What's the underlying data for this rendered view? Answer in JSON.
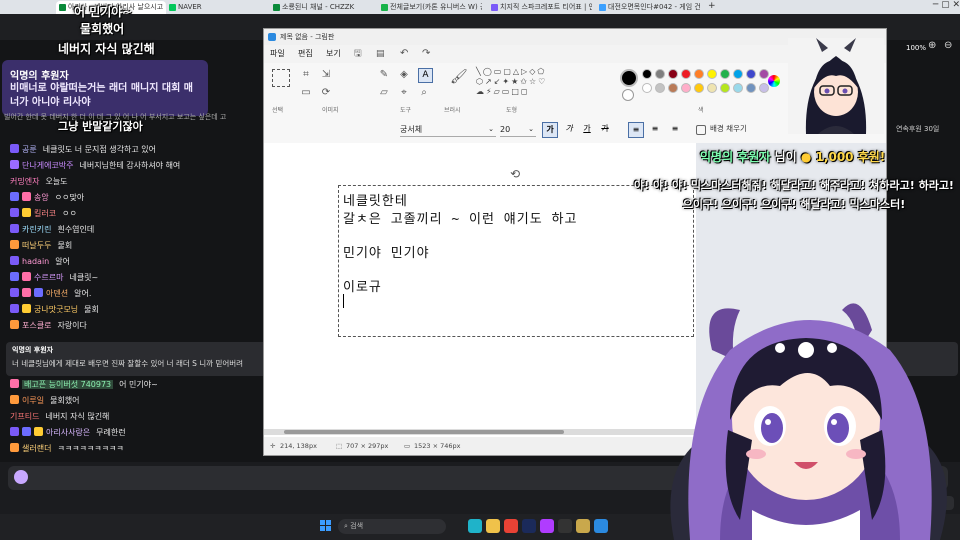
{
  "browser": {
    "tabs": [
      {
        "label": "아리사 - 네버지 아리사 날으시고 바치적상 CI - CHZZK",
        "color": "#0a8a3a",
        "active": true
      },
      {
        "label": "NAVER",
        "color": "#03c75a"
      },
      {
        "label": "소룡된니 채널 - CHZZK",
        "color": "#0a8a3a"
      },
      {
        "label": "전체글보기(카톤 유니버스 W) 공",
        "color": "#19b34a"
      },
      {
        "label": "치지직 스파크레포트 티어표 | 인",
        "color": "#7a5af8"
      },
      {
        "label": "대전오면목인다#042 - 게임 건의",
        "color": "#3ba0ff"
      }
    ],
    "page_title": "아리사 - 네버지 아리사 날으시고 바치적상 CI - CHZZK"
  },
  "overlay": {
    "top_lines": [
      "어 민기야~",
      "물회했어",
      "네버지 자식 많긴해"
    ],
    "mid_line": "그냥 반말같기잖아",
    "donation_top": {
      "title": "익명의 후원자",
      "message": "비매너로 야랄떠는거는 래더 매니지 대회 매너가 아니야 리사야"
    },
    "big_donation": {
      "prefix": "익명의 후원자",
      "suffix": "님이",
      "amount": "1,000 후원!",
      "message": "야! 야! 야! 믹스마스터해줘! 해달라고! 해주라고! 쳐하라고! 하라고! 으이구! 으이구! 으이구! 해달라고! 믹스마스터!"
    },
    "subscribe_text": "연속후원 30일",
    "chat_head_text": "빌어간 한데 못 데버지 한 더 이 데 그 있 어 나 어 부서지고 보고는 싶은데 고"
  },
  "chat": [
    {
      "nick": "공룬",
      "nick_color": "#b9b9ff",
      "msg": "네클릿도 너 문지점 생각하고 있어",
      "badges": [
        "#7a5af8"
      ]
    },
    {
      "nick": "단나게에코박주",
      "nick_color": "#c98cff",
      "msg": "네버지님한테 감사하셔야 해여",
      "badges": [
        "#9b6cff"
      ]
    },
    {
      "nick": "커밍엔자",
      "nick_color": "#ff7fbf",
      "msg": "오늘도",
      "badges": []
    },
    {
      "nick": "송앙",
      "nick_color": "#ff9ad5",
      "msg": "ㅇㅇ맞아",
      "badges": [
        "#6c6cff",
        "#ff6fa8"
      ]
    },
    {
      "nick": "킬러코",
      "nick_color": "#ff8888",
      "msg": "ㅇㅇ",
      "badges": [
        "#7a5af8",
        "#ffcc33"
      ]
    },
    {
      "nick": "카린키린",
      "nick_color": "#9fe0ff",
      "msg": "흰수염인데",
      "badges": [
        "#7a5af8"
      ]
    },
    {
      "nick": "떠날두두",
      "nick_color": "#ffd27a",
      "msg": "물회",
      "badges": [
        "#ff9a3c"
      ]
    },
    {
      "nick": "hadain",
      "nick_color": "#ff9ad5",
      "msg": "알어",
      "badges": [
        "#7a5af8"
      ]
    },
    {
      "nick": "수르르마",
      "nick_color": "#d99bff",
      "msg": "네클릿~",
      "badges": [
        "#6c6cff",
        "#ff6fa8"
      ]
    },
    {
      "nick": "아덴션",
      "nick_color": "#ffb36b",
      "msg": "알어.",
      "badges": [
        "#7a5af8",
        "#ff6fa8",
        "#6c6cff"
      ]
    },
    {
      "nick": "궁나맛굿모닝",
      "nick_color": "#ffcc66",
      "msg": "물회",
      "badges": [
        "#7a5af8",
        "#ffcc33"
      ]
    },
    {
      "nick": "포스클로",
      "nick_color": "#ffb0d0",
      "msg": "자랑이다",
      "badges": [
        "#ff9a3c"
      ]
    }
  ],
  "chat_donation": {
    "title": "익명의 후원자",
    "message": "너 네클릿님에게 제대로 배우면 진짜 잘할수 있어 너 래더 S 니까 믿어버려"
  },
  "chat2": [
    {
      "nick": "배고픈 능이버섯 740973",
      "nick_color": "#8cf0b0",
      "msg": "어 민기야~",
      "badges": [
        "#ff6fa8"
      ],
      "highlight": true
    },
    {
      "nick": "이루일",
      "nick_color": "#ff9a5a",
      "msg": "물회했어",
      "badges": [
        "#ff9a3c"
      ]
    },
    {
      "nick": "기프티드",
      "nick_color": "#ff7777",
      "msg": "네버지 자식 많긴해",
      "badges": []
    },
    {
      "nick": "아리사사랑은",
      "nick_color": "#d8b8ff",
      "msg": "무례한런",
      "badges": [
        "#7a5af8",
        "#6c6cff",
        "#ffcc33"
      ]
    },
    {
      "nick": "샐러랜더",
      "nick_color": "#ffd27a",
      "msg": "ㅋㅋㅋㅋㅋㅋㅋㅋㅋ",
      "badges": [
        "#ff9a3c"
      ]
    }
  ],
  "paint": {
    "title": "제목 없음 - 그림판",
    "menu": [
      "파일",
      "편집",
      "보기"
    ],
    "groups": [
      "선택",
      "이미지",
      "도구",
      "브러시",
      "도형",
      "색"
    ],
    "font_name": "궁서체",
    "font_size": "20",
    "style_buttons": [
      "가",
      "가",
      "가",
      "가"
    ],
    "bg_fill_label": "배경 채우기",
    "canvas_lines": [
      "네클릿한테",
      "갈ㅊ은 고졸끼리 ~ 이런 얘기도 하고",
      "",
      "민기야 민기야",
      "",
      "이로규"
    ],
    "status_cursor": "214, 138px",
    "status_selection": "707 × 297px",
    "status_canvas": "1523 × 746px",
    "zoom": "100%",
    "palette": [
      "#000000",
      "#7f7f7f",
      "#880015",
      "#ed1c24",
      "#ff7f27",
      "#fff200",
      "#22b14c",
      "#00a2e8",
      "#3f48cc",
      "#a349a4",
      "#ffffff",
      "#c3c3c3",
      "#b97a57",
      "#ffaec9",
      "#ffc90e",
      "#efe4b0",
      "#b5e61d",
      "#99d9ea",
      "#7092be",
      "#c8bfe7"
    ]
  },
  "chat_input": {
    "placeholder": ""
  },
  "send_label": "채팅",
  "taskbar": {
    "search_placeholder": "검색",
    "icons": [
      {
        "name": "windows-icon",
        "color": "#3b9cff"
      },
      {
        "name": "edge-icon",
        "color": "#1fb3c9"
      },
      {
        "name": "explorer-icon",
        "color": "#f0c24a"
      },
      {
        "name": "chrome-icon",
        "color": "#e94235"
      },
      {
        "name": "photoshop-icon",
        "color": "#1b2a5a"
      },
      {
        "name": "app-icon",
        "color": "#b03cff"
      },
      {
        "name": "obs-icon",
        "color": "#333333"
      },
      {
        "name": "league-icon",
        "color": "#c9a84c"
      },
      {
        "name": "paint-icon",
        "color": "#2b8ae0"
      }
    ]
  }
}
